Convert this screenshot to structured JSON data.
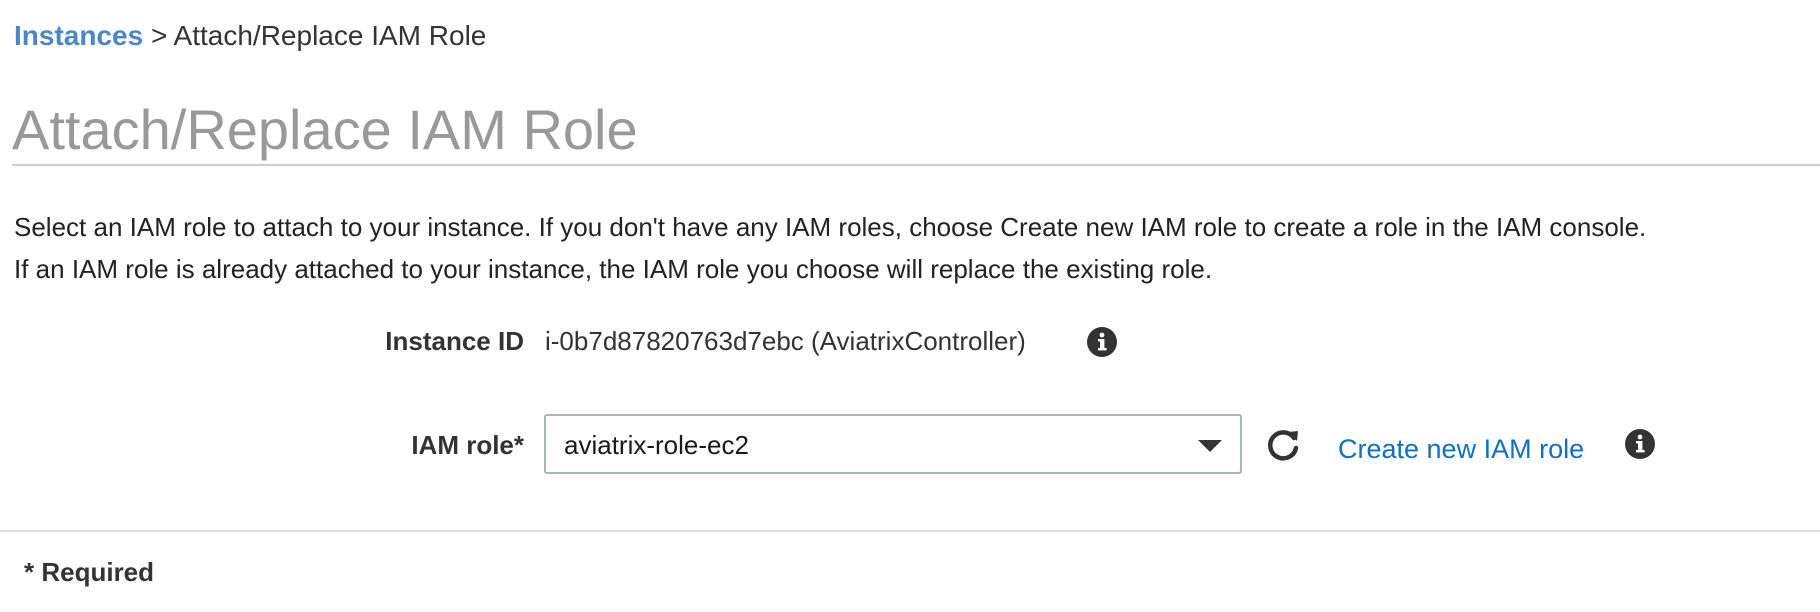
{
  "breadcrumb": {
    "parent_label": "Instances",
    "separator": ">",
    "current_label": "Attach/Replace IAM Role"
  },
  "page": {
    "title": "Attach/Replace IAM Role",
    "description_line1": "Select an IAM role to attach to your instance. If you don't have any IAM roles, choose Create new IAM role to create a role in the IAM console.",
    "description_line2": "If an IAM role is already attached to your instance, the IAM role you choose will replace the existing role."
  },
  "form": {
    "instance_label": "Instance ID",
    "instance_value": "i-0b7d87820763d7ebc (AviatrixController)",
    "role_label": "IAM role*",
    "role_selected": "aviatrix-role-ec2",
    "create_role_link": "Create new IAM role"
  },
  "footer": {
    "required_note": "* Required"
  },
  "icons": {
    "info": "info-icon",
    "refresh": "refresh-icon",
    "dropdown": "chevron-down-icon"
  },
  "colors": {
    "link": "#0f6fc5",
    "breadcrumb_link": "#4a86c8",
    "title": "#999999",
    "icon": "#333333"
  }
}
